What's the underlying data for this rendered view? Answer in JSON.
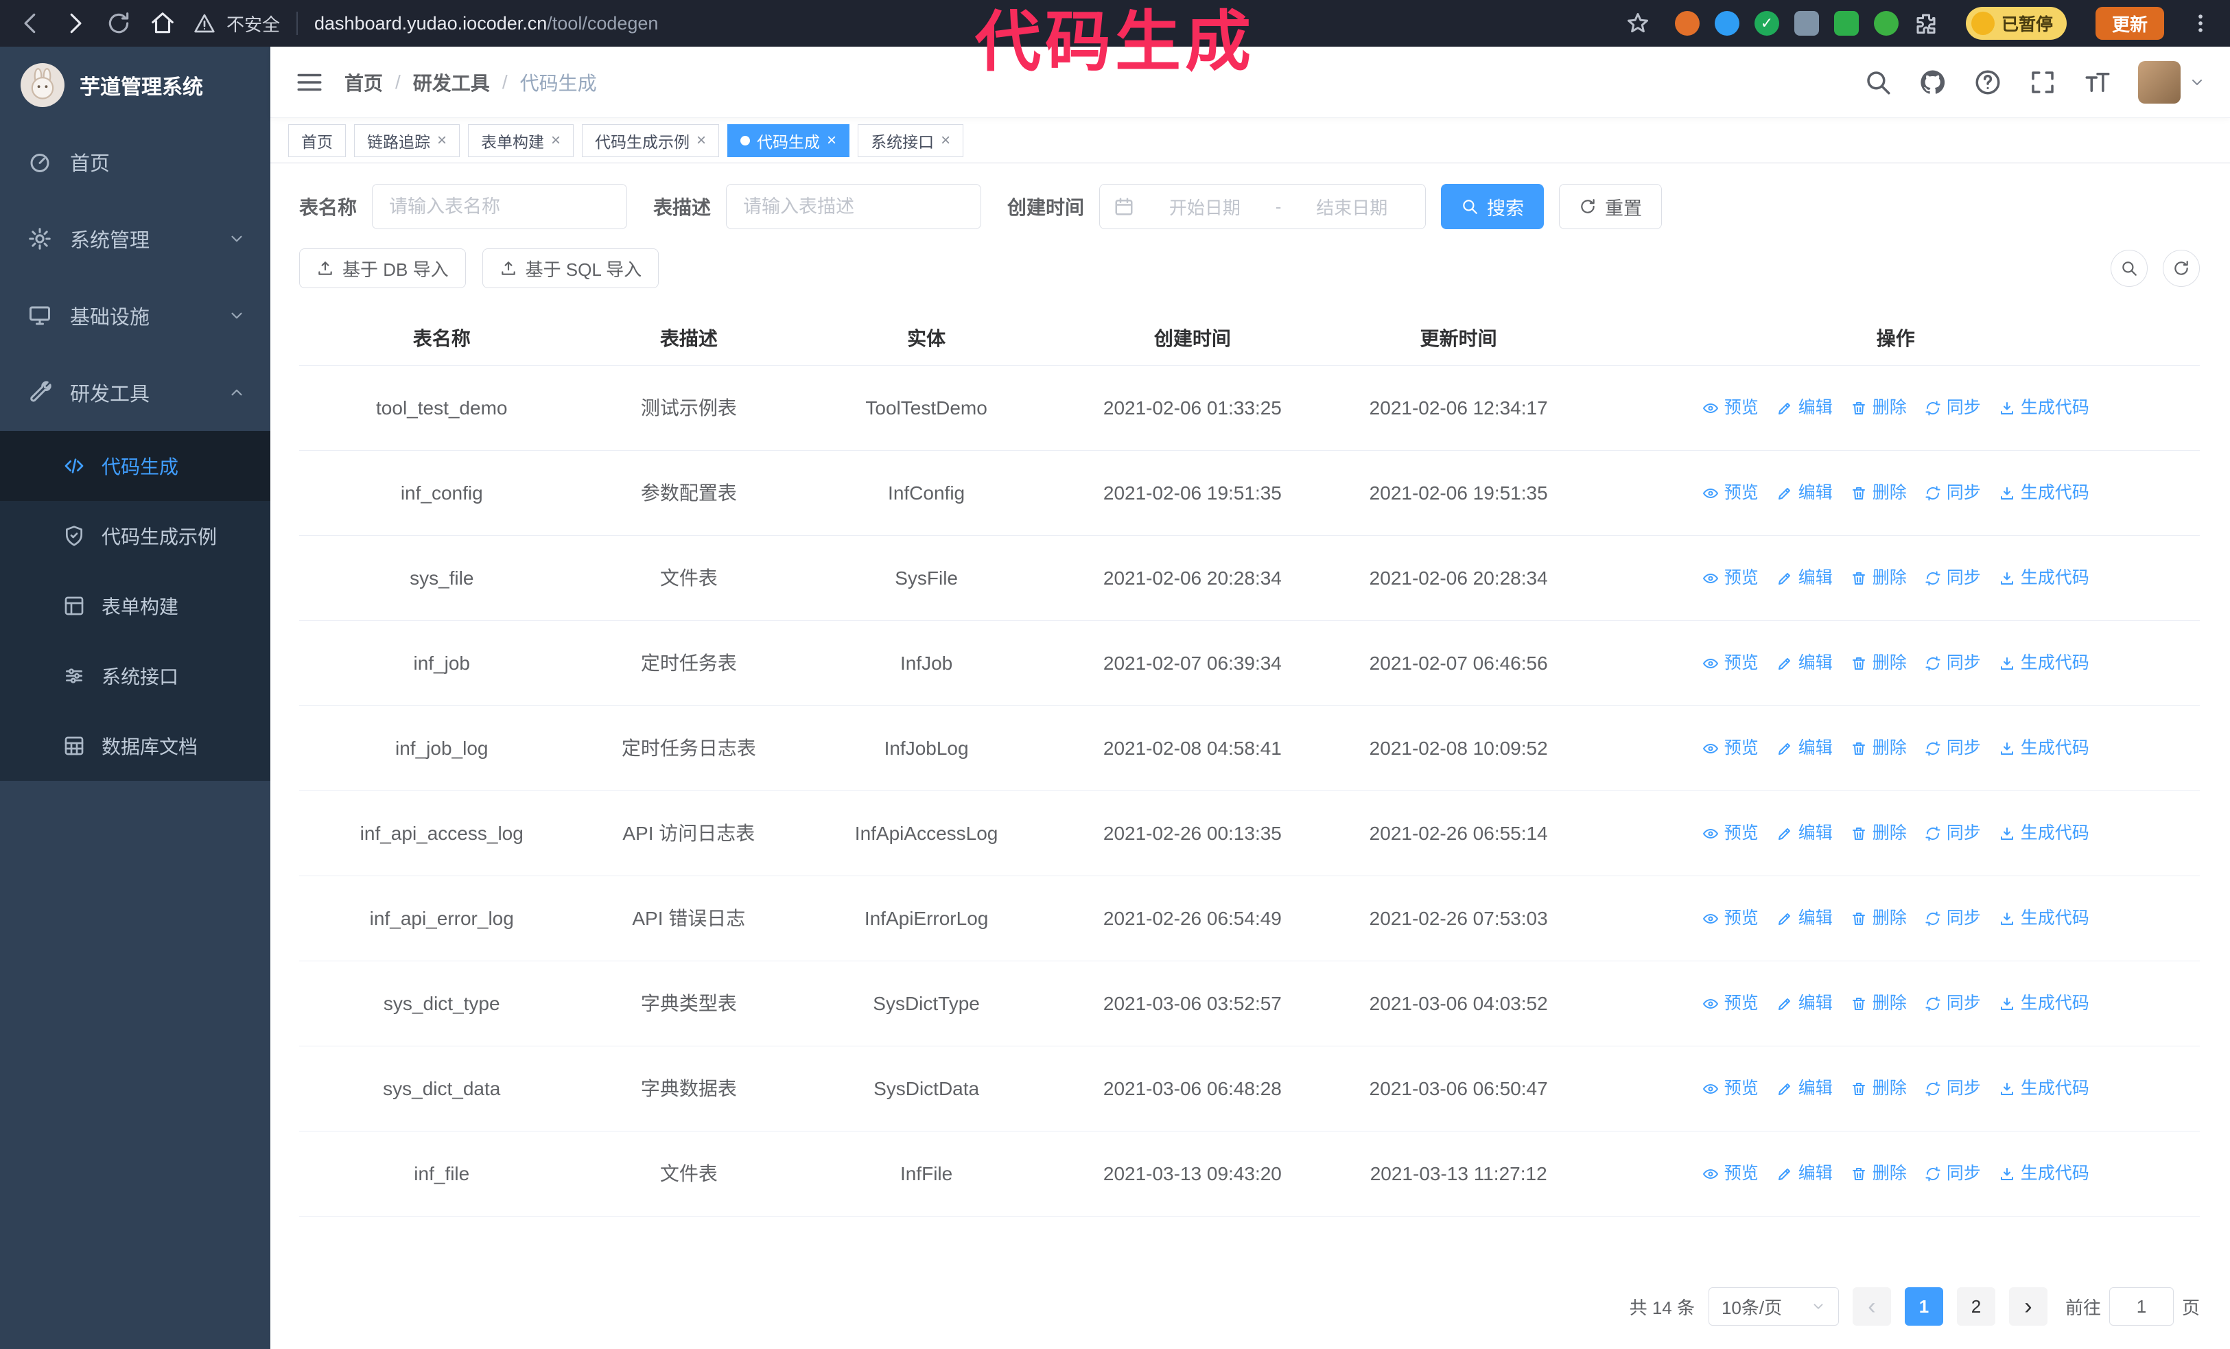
{
  "browser": {
    "security_label": "不安全",
    "url_host": "dashboard.yudao.iocoder.cn",
    "url_path": "/tool/codegen",
    "paused_badge": "已暂停",
    "update_button": "更新"
  },
  "annotation": {
    "text": "代码生成"
  },
  "sidebar": {
    "logo_title": "芋道管理系统",
    "items": [
      {
        "label": "首页"
      },
      {
        "label": "系统管理"
      },
      {
        "label": "基础设施"
      },
      {
        "label": "研发工具"
      }
    ],
    "sub_items": [
      {
        "label": "代码生成",
        "active": true
      },
      {
        "label": "代码生成示例"
      },
      {
        "label": "表单构建"
      },
      {
        "label": "系统接口"
      },
      {
        "label": "数据库文档"
      }
    ]
  },
  "header": {
    "breadcrumb": [
      "首页",
      "研发工具",
      "代码生成"
    ]
  },
  "tabs": [
    {
      "label": "首页"
    },
    {
      "label": "链路追踪"
    },
    {
      "label": "表单构建"
    },
    {
      "label": "代码生成示例"
    },
    {
      "label": "代码生成",
      "active": true
    },
    {
      "label": "系统接口"
    }
  ],
  "filters": {
    "table_name_label": "表名称",
    "table_name_placeholder": "请输入表名称",
    "table_desc_label": "表描述",
    "table_desc_placeholder": "请输入表描述",
    "create_time_label": "创建时间",
    "date_start_placeholder": "开始日期",
    "date_separator": "-",
    "date_end_placeholder": "结束日期",
    "search_button": "搜索",
    "reset_button": "重置"
  },
  "toolbar": {
    "import_db": "基于 DB 导入",
    "import_sql": "基于 SQL 导入"
  },
  "table": {
    "columns": [
      "表名称",
      "表描述",
      "实体",
      "创建时间",
      "更新时间",
      "操作"
    ],
    "actions": [
      "预览",
      "编辑",
      "删除",
      "同步",
      "生成代码"
    ],
    "rows": [
      {
        "name": "tool_test_demo",
        "desc": "测试示例表",
        "entity": "ToolTestDemo",
        "created": "2021-02-06 01:33:25",
        "updated": "2021-02-06 12:34:17"
      },
      {
        "name": "inf_config",
        "desc": "参数配置表",
        "entity": "InfConfig",
        "created": "2021-02-06 19:51:35",
        "updated": "2021-02-06 19:51:35"
      },
      {
        "name": "sys_file",
        "desc": "文件表",
        "entity": "SysFile",
        "created": "2021-02-06 20:28:34",
        "updated": "2021-02-06 20:28:34"
      },
      {
        "name": "inf_job",
        "desc": "定时任务表",
        "entity": "InfJob",
        "created": "2021-02-07 06:39:34",
        "updated": "2021-02-07 06:46:56"
      },
      {
        "name": "inf_job_log",
        "desc": "定时任务日志表",
        "entity": "InfJobLog",
        "created": "2021-02-08 04:58:41",
        "updated": "2021-02-08 10:09:52"
      },
      {
        "name": "inf_api_access_log",
        "desc": "API 访问日志表",
        "entity": "InfApiAccessLog",
        "created": "2021-02-26 00:13:35",
        "updated": "2021-02-26 06:55:14"
      },
      {
        "name": "inf_api_error_log",
        "desc": "API 错误日志",
        "entity": "InfApiErrorLog",
        "created": "2021-02-26 06:54:49",
        "updated": "2021-02-26 07:53:03"
      },
      {
        "name": "sys_dict_type",
        "desc": "字典类型表",
        "entity": "SysDictType",
        "created": "2021-03-06 03:52:57",
        "updated": "2021-03-06 04:03:52"
      },
      {
        "name": "sys_dict_data",
        "desc": "字典数据表",
        "entity": "SysDictData",
        "created": "2021-03-06 06:48:28",
        "updated": "2021-03-06 06:50:47"
      },
      {
        "name": "inf_file",
        "desc": "文件表",
        "entity": "InfFile",
        "created": "2021-03-13 09:43:20",
        "updated": "2021-03-13 11:27:12"
      }
    ]
  },
  "pagination": {
    "total": "共 14 条",
    "page_size": "10条/页",
    "pages": [
      "1",
      "2"
    ],
    "active_page": "1",
    "prev": "‹",
    "next": "›",
    "goto_label": "前往",
    "goto_value": "1",
    "goto_suffix": "页"
  },
  "colors": {
    "accent": "#409eff",
    "annotation": "#f72c5b",
    "sidebar_bg": "#304156",
    "sidebar_submenu_bg": "#1f2d3d",
    "chrome_bg": "#1f2430",
    "update_button_bg": "#dd6b20",
    "paused_pill_bg": "#f6d464"
  },
  "icons": {
    "browser": [
      "back-icon",
      "forward-icon",
      "reload-icon",
      "home-icon",
      "warning-icon",
      "star-icon",
      "extensions-puzzle-icon",
      "kebab-menu-icon"
    ],
    "navbar": [
      "hamburger-icon",
      "search-icon",
      "github-icon",
      "help-icon",
      "fullscreen-icon",
      "font-size-icon",
      "caret-down-icon"
    ],
    "sidebar": [
      "dashboard-icon",
      "gear-icon",
      "infrastructure-icon",
      "tools-icon",
      "code-icon",
      "shield-icon",
      "form-icon",
      "sliders-icon",
      "database-grid-icon"
    ],
    "table_actions": [
      "eye-icon",
      "edit-icon",
      "delete-icon",
      "sync-icon",
      "generate-code-icon"
    ]
  }
}
